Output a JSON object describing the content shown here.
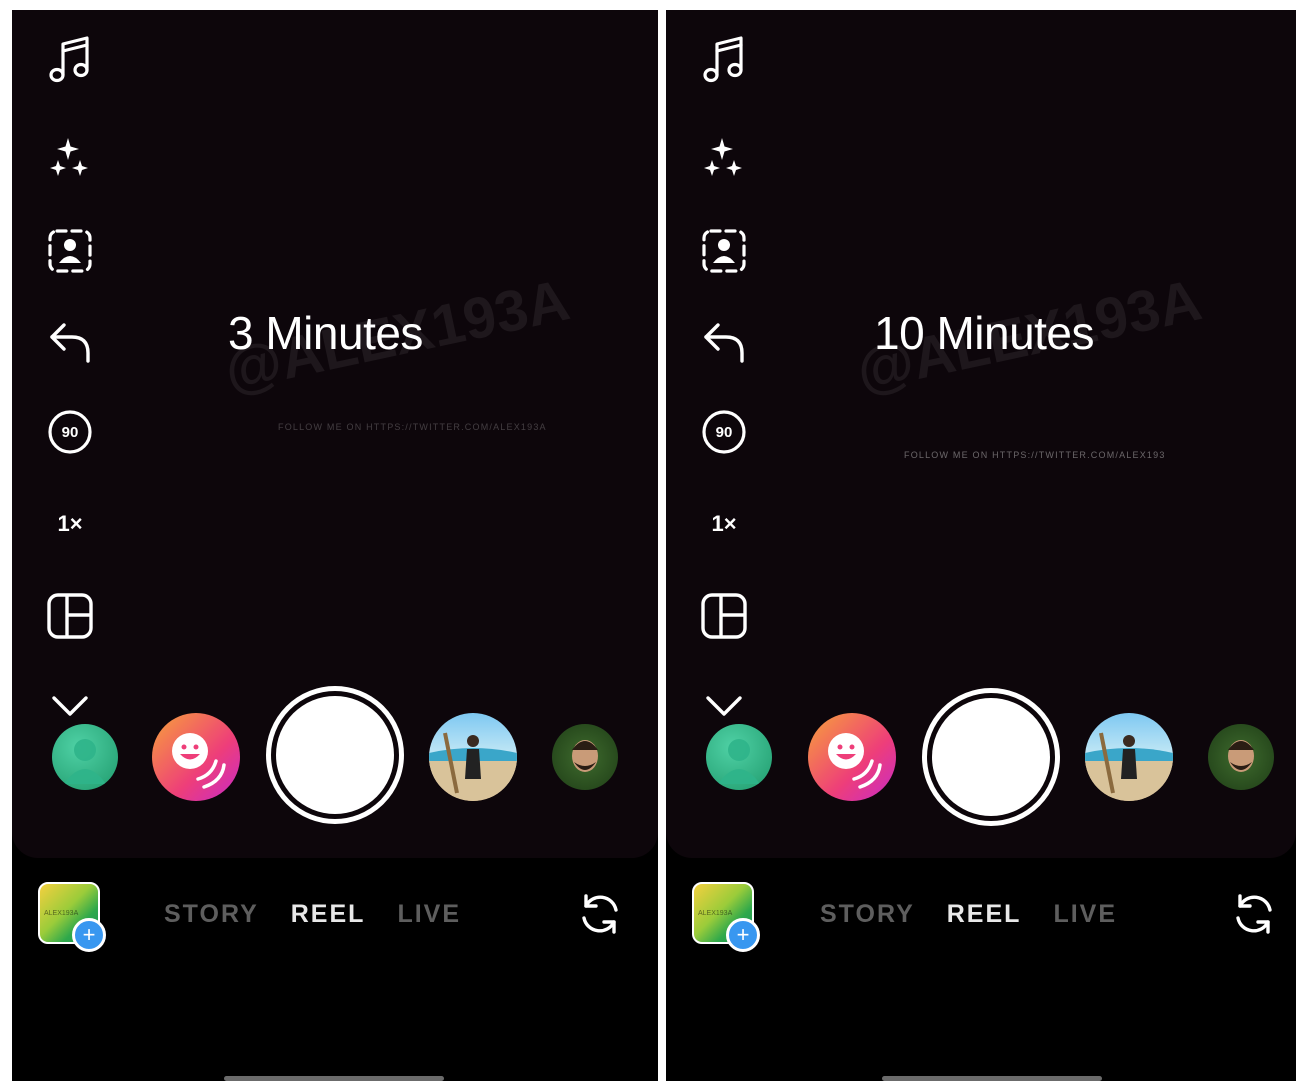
{
  "screens": [
    {
      "duration_label": "3 Minutes",
      "watermark": "@ALEX193A",
      "watermark_follow": "FOLLOW ME ON HTTPS://TWITTER.COM/ALEX193A",
      "speed_label": "1×",
      "timer_label": "90",
      "gallery_label": "ALEX193A"
    },
    {
      "duration_label": "10 Minutes",
      "watermark": "@ALEX193A",
      "watermark_follow": "FOLLOW ME ON HTTPS://TWITTER.COM/ALEX193",
      "speed_label": "1×",
      "timer_label": "90",
      "gallery_label": "ALEX193A"
    }
  ],
  "modes": [
    "STORY",
    "REEL",
    "LIVE"
  ],
  "active_mode": "REEL",
  "colors": {
    "background": "#000000",
    "camera": "#0d060b",
    "accent": "#3897f0"
  },
  "icons": [
    "music-icon",
    "effects-sparkle-icon",
    "green-screen-icon",
    "undo-icon",
    "timer-icon",
    "speed-label",
    "layout-icon",
    "chevron-down-icon",
    "flip-camera-icon",
    "add-plus-icon"
  ]
}
